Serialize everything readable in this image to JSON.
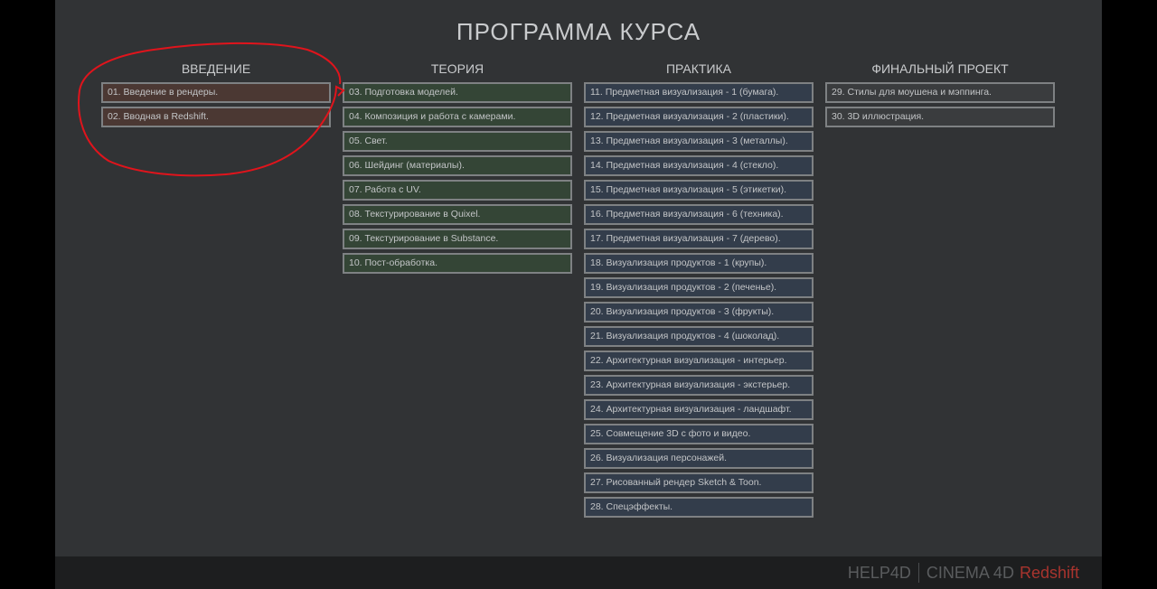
{
  "title": "ПРОГРАММА КУРСА",
  "columns": [
    {
      "heading": "ВВЕДЕНИЕ",
      "items": [
        "01. Введение в рендеры.",
        "02. Вводная в Redshift."
      ]
    },
    {
      "heading": "ТЕОРИЯ",
      "items": [
        "03. Подготовка моделей.",
        "04. Композиция и работа с камерами.",
        "05. Свет.",
        "06. Шейдинг (материалы).",
        "07. Работа с UV.",
        "08. Текстурирование в Quixel.",
        "09. Текстурирование в Substance.",
        "10. Пост-обработка."
      ]
    },
    {
      "heading": "ПРАКТИКА",
      "items": [
        "11. Предметная визуализация - 1 (бумага).",
        "12. Предметная визуализация - 2 (пластики).",
        "13. Предметная визуализация - 3 (металлы).",
        "14. Предметная визуализация - 4 (стекло).",
        "15. Предметная визуализация - 5 (этикетки).",
        "16. Предметная визуализация - 6 (техника).",
        "17. Предметная визуализация - 7 (дерево).",
        "18. Визуализация продуктов - 1 (крупы).",
        "19. Визуализация продуктов - 2 (печенье).",
        "20. Визуализация продуктов - 3 (фрукты).",
        "21. Визуализация продуктов - 4 (шоколад).",
        "22. Архитектурная визуализация - интерьер.",
        "23. Архитектурная визуализация - экстерьер.",
        "24. Архитектурная визуализация - ландшафт.",
        "25. Совмещение 3D с фото и видео.",
        "26. Визуализация персонажей.",
        "27. Рисованный рендер Sketch & Toon.",
        "28. Спецэффекты."
      ]
    },
    {
      "heading": "ФИНАЛЬНЫЙ ПРОЕКТ",
      "items": [
        "29. Стилы для моушена и мэппинга.",
        "30. 3D иллюстрация."
      ]
    }
  ],
  "brand": {
    "left": "HELP4D",
    "middle": "CINEMA 4D",
    "accent": "Redshift"
  },
  "colors": {
    "annotation": "#e0141c",
    "brand_accent": "#a8342e"
  }
}
